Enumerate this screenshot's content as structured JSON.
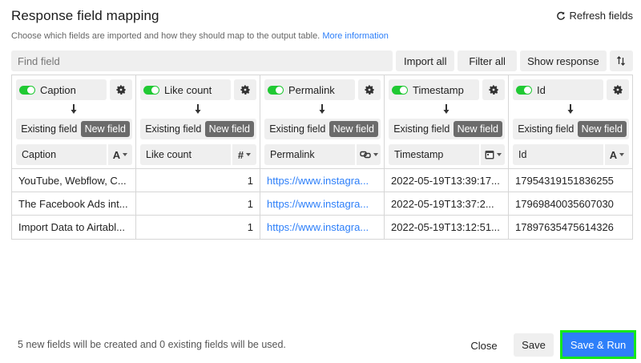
{
  "header": {
    "title": "Response field mapping",
    "refresh_label": "Refresh fields"
  },
  "subtitle": {
    "text": "Choose which fields are imported and how they should map to the output table.",
    "link": "More information"
  },
  "toolbar": {
    "find_placeholder": "Find field",
    "import_all": "Import all",
    "filter_all": "Filter all",
    "show_response": "Show response"
  },
  "mode": {
    "existing": "Existing field",
    "new": "New field"
  },
  "columns": [
    {
      "name": "Caption",
      "target": "Caption",
      "type_icon": "A"
    },
    {
      "name": "Like count",
      "target": "Like count",
      "type_icon": "#"
    },
    {
      "name": "Permalink",
      "target": "Permalink",
      "type_icon": "link"
    },
    {
      "name": "Timestamp",
      "target": "Timestamp",
      "type_icon": "calendar"
    },
    {
      "name": "Id",
      "target": "Id",
      "type_icon": "A"
    }
  ],
  "rows": [
    [
      "YouTube, Webflow, C...",
      "1",
      "https://www.instagra...",
      "2022-05-19T13:39:17...",
      "17954319151836255"
    ],
    [
      "The Facebook Ads int...",
      "1",
      "https://www.instagra...",
      "2022-05-19T13:37:2...",
      "17969840035607030"
    ],
    [
      "Import Data to Airtabl...",
      "1",
      "https://www.instagra...",
      "2022-05-19T13:12:51...",
      "17897635475614326"
    ]
  ],
  "footer": {
    "info": "5 new fields will be created and 0 existing fields will be used.",
    "close": "Close",
    "save": "Save",
    "save_run": "Save & Run"
  },
  "colors": {
    "accent": "#2d7ff9",
    "toggle_on": "#20c933",
    "highlight": "#15e81a",
    "new_field_bg": "#6b6b6b"
  }
}
